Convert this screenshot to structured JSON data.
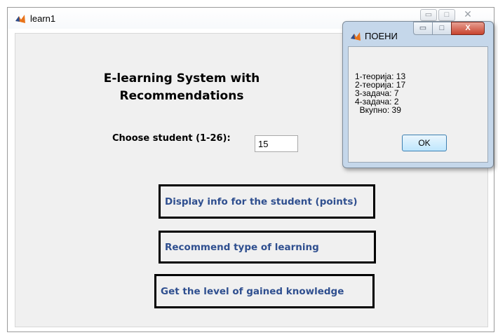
{
  "window": {
    "title": "learn1",
    "minimize_glyph": "▭",
    "maximize_glyph": "□",
    "close_glyph": "✕"
  },
  "app": {
    "heading_line1": "E-learning System with",
    "heading_line2": "Recommendations",
    "choose_label": "Choose student (1-26):",
    "student_value": "15",
    "buttons": {
      "display_info": "Display info for the student (points)",
      "recommend": "Recommend type of learning",
      "level": "Get the level of gained knowledge"
    }
  },
  "dialog": {
    "title": "ПОЕНИ",
    "minimize_glyph": "▭",
    "maximize_glyph": "□",
    "close_glyph": "X",
    "points": [
      {
        "label": "1-теорија:",
        "value": "13"
      },
      {
        "label": "2-теорија:",
        "value": "17"
      },
      {
        "label": "3-задача:",
        "value": "7"
      },
      {
        "label": "4-задача:",
        "value": "2"
      },
      {
        "label": "  Вкупно:",
        "value": "39"
      }
    ],
    "ok_label": "OK"
  },
  "colors": {
    "button_text": "#2f4f8f",
    "dialog_frame": "#c5d7ea",
    "icon_orange": "#e8731a",
    "icon_blue": "#2a4d8f"
  }
}
